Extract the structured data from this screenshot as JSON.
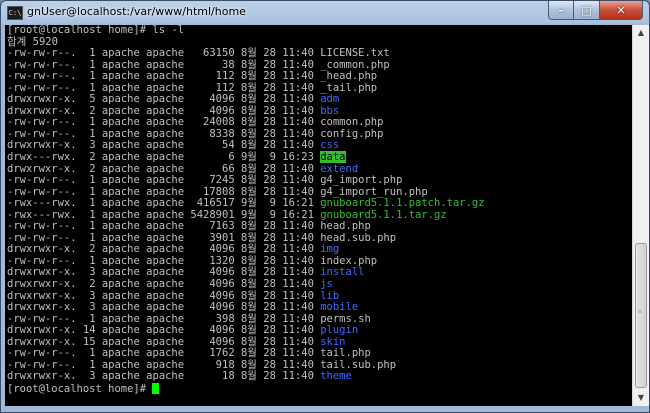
{
  "window": {
    "title": "gnUser@localhost:/var/www/html/home",
    "icon_text": "C:\\",
    "buttons": {
      "minimize": "–",
      "maximize": "□",
      "close": "✕"
    }
  },
  "terminal": {
    "colors": {
      "background": "#000000",
      "text": "#c0c0c0",
      "directory": "#3e6bff",
      "executable": "#30c030",
      "cursor": "#00ff00"
    },
    "lines": [
      {
        "text": "[root@localhost home]# ls -l"
      },
      {
        "text": "합계 5920"
      },
      {
        "perm": "-rw-rw-r--.",
        "links": " 1",
        "owner": "apache",
        "group": "apache",
        "size": "  63150",
        "month": "8월",
        "day": "28",
        "time": "11:40",
        "name": "LICENSE.txt",
        "kind": "file"
      },
      {
        "perm": "-rw-rw-r--.",
        "links": " 1",
        "owner": "apache",
        "group": "apache",
        "size": "     38",
        "month": "8월",
        "day": "28",
        "time": "11:40",
        "name": "_common.php",
        "kind": "file"
      },
      {
        "perm": "-rw-rw-r--.",
        "links": " 1",
        "owner": "apache",
        "group": "apache",
        "size": "    112",
        "month": "8월",
        "day": "28",
        "time": "11:40",
        "name": "_head.php",
        "kind": "file"
      },
      {
        "perm": "-rw-rw-r--.",
        "links": " 1",
        "owner": "apache",
        "group": "apache",
        "size": "    112",
        "month": "8월",
        "day": "28",
        "time": "11:40",
        "name": "_tail.php",
        "kind": "file"
      },
      {
        "perm": "drwxrwxr-x.",
        "links": " 5",
        "owner": "apache",
        "group": "apache",
        "size": "   4096",
        "month": "8월",
        "day": "28",
        "time": "11:40",
        "name": "adm",
        "kind": "dir"
      },
      {
        "perm": "drwxrwxr-x.",
        "links": " 2",
        "owner": "apache",
        "group": "apache",
        "size": "   4096",
        "month": "8월",
        "day": "28",
        "time": "11:40",
        "name": "bbs",
        "kind": "dir"
      },
      {
        "perm": "-rw-rw-r--.",
        "links": " 1",
        "owner": "apache",
        "group": "apache",
        "size": "  24008",
        "month": "8월",
        "day": "28",
        "time": "11:40",
        "name": "common.php",
        "kind": "file"
      },
      {
        "perm": "-rw-rw-r--.",
        "links": " 1",
        "owner": "apache",
        "group": "apache",
        "size": "   8338",
        "month": "8월",
        "day": "28",
        "time": "11:40",
        "name": "config.php",
        "kind": "file"
      },
      {
        "perm": "drwxrwxr-x.",
        "links": " 3",
        "owner": "apache",
        "group": "apache",
        "size": "     54",
        "month": "8월",
        "day": "28",
        "time": "11:40",
        "name": "css",
        "kind": "dir"
      },
      {
        "perm": "drwx---rwx.",
        "links": " 2",
        "owner": "apache",
        "group": "apache",
        "size": "      6",
        "month": "9월",
        "day": " 9",
        "time": "16:23",
        "name": "data",
        "kind": "sticky"
      },
      {
        "perm": "drwxrwxr-x.",
        "links": " 2",
        "owner": "apache",
        "group": "apache",
        "size": "     66",
        "month": "8월",
        "day": "28",
        "time": "11:40",
        "name": "extend",
        "kind": "dir"
      },
      {
        "perm": "-rw-rw-r--.",
        "links": " 1",
        "owner": "apache",
        "group": "apache",
        "size": "   7245",
        "month": "8월",
        "day": "28",
        "time": "11:40",
        "name": "g4_import.php",
        "kind": "file"
      },
      {
        "perm": "-rw-rw-r--.",
        "links": " 1",
        "owner": "apache",
        "group": "apache",
        "size": "  17808",
        "month": "8월",
        "day": "28",
        "time": "11:40",
        "name": "g4_import_run.php",
        "kind": "file"
      },
      {
        "perm": "-rwx---rwx.",
        "links": " 1",
        "owner": "apache",
        "group": "apache",
        "size": " 416517",
        "month": "9월",
        "day": " 9",
        "time": "16:21",
        "name": "gnuboard5.1.1.patch.tar.gz",
        "kind": "exec"
      },
      {
        "perm": "-rwx---rwx.",
        "links": " 1",
        "owner": "apache",
        "group": "apache",
        "size": "5428901",
        "month": "9월",
        "day": " 9",
        "time": "16:21",
        "name": "gnuboard5.1.1.tar.gz",
        "kind": "exec"
      },
      {
        "perm": "-rw-rw-r--.",
        "links": " 1",
        "owner": "apache",
        "group": "apache",
        "size": "   7163",
        "month": "8월",
        "day": "28",
        "time": "11:40",
        "name": "head.php",
        "kind": "file"
      },
      {
        "perm": "-rw-rw-r--.",
        "links": " 1",
        "owner": "apache",
        "group": "apache",
        "size": "   3901",
        "month": "8월",
        "day": "28",
        "time": "11:40",
        "name": "head.sub.php",
        "kind": "file"
      },
      {
        "perm": "drwxrwxr-x.",
        "links": " 2",
        "owner": "apache",
        "group": "apache",
        "size": "   4096",
        "month": "8월",
        "day": "28",
        "time": "11:40",
        "name": "img",
        "kind": "dir"
      },
      {
        "perm": "-rw-rw-r--.",
        "links": " 1",
        "owner": "apache",
        "group": "apache",
        "size": "   1320",
        "month": "8월",
        "day": "28",
        "time": "11:40",
        "name": "index.php",
        "kind": "file"
      },
      {
        "perm": "drwxrwxr-x.",
        "links": " 3",
        "owner": "apache",
        "group": "apache",
        "size": "   4096",
        "month": "8월",
        "day": "28",
        "time": "11:40",
        "name": "install",
        "kind": "dir"
      },
      {
        "perm": "drwxrwxr-x.",
        "links": " 2",
        "owner": "apache",
        "group": "apache",
        "size": "   4096",
        "month": "8월",
        "day": "28",
        "time": "11:40",
        "name": "js",
        "kind": "dir"
      },
      {
        "perm": "drwxrwxr-x.",
        "links": " 3",
        "owner": "apache",
        "group": "apache",
        "size": "   4096",
        "month": "8월",
        "day": "28",
        "time": "11:40",
        "name": "lib",
        "kind": "dir"
      },
      {
        "perm": "drwxrwxr-x.",
        "links": " 3",
        "owner": "apache",
        "group": "apache",
        "size": "   4096",
        "month": "8월",
        "day": "28",
        "time": "11:40",
        "name": "mobile",
        "kind": "dir"
      },
      {
        "perm": "-rw-rw-r--.",
        "links": " 1",
        "owner": "apache",
        "group": "apache",
        "size": "    398",
        "month": "8월",
        "day": "28",
        "time": "11:40",
        "name": "perms.sh",
        "kind": "file"
      },
      {
        "perm": "drwxrwxr-x.",
        "links": "14",
        "owner": "apache",
        "group": "apache",
        "size": "   4096",
        "month": "8월",
        "day": "28",
        "time": "11:40",
        "name": "plugin",
        "kind": "dir"
      },
      {
        "perm": "drwxrwxr-x.",
        "links": "15",
        "owner": "apache",
        "group": "apache",
        "size": "   4096",
        "month": "8월",
        "day": "28",
        "time": "11:40",
        "name": "skin",
        "kind": "dir"
      },
      {
        "perm": "-rw-rw-r--.",
        "links": " 1",
        "owner": "apache",
        "group": "apache",
        "size": "   1762",
        "month": "8월",
        "day": "28",
        "time": "11:40",
        "name": "tail.php",
        "kind": "file"
      },
      {
        "perm": "-rw-rw-r--.",
        "links": " 1",
        "owner": "apache",
        "group": "apache",
        "size": "    918",
        "month": "8월",
        "day": "28",
        "time": "11:40",
        "name": "tail.sub.php",
        "kind": "file"
      },
      {
        "perm": "drwxrwxr-x.",
        "links": " 3",
        "owner": "apache",
        "group": "apache",
        "size": "     18",
        "month": "8월",
        "day": "28",
        "time": "11:40",
        "name": "theme",
        "kind": "dir"
      }
    ],
    "prompt": "[root@localhost home]# "
  },
  "scrollbar": {
    "up_arrow": "▲",
    "down_arrow": "▼",
    "grip": "≡"
  }
}
